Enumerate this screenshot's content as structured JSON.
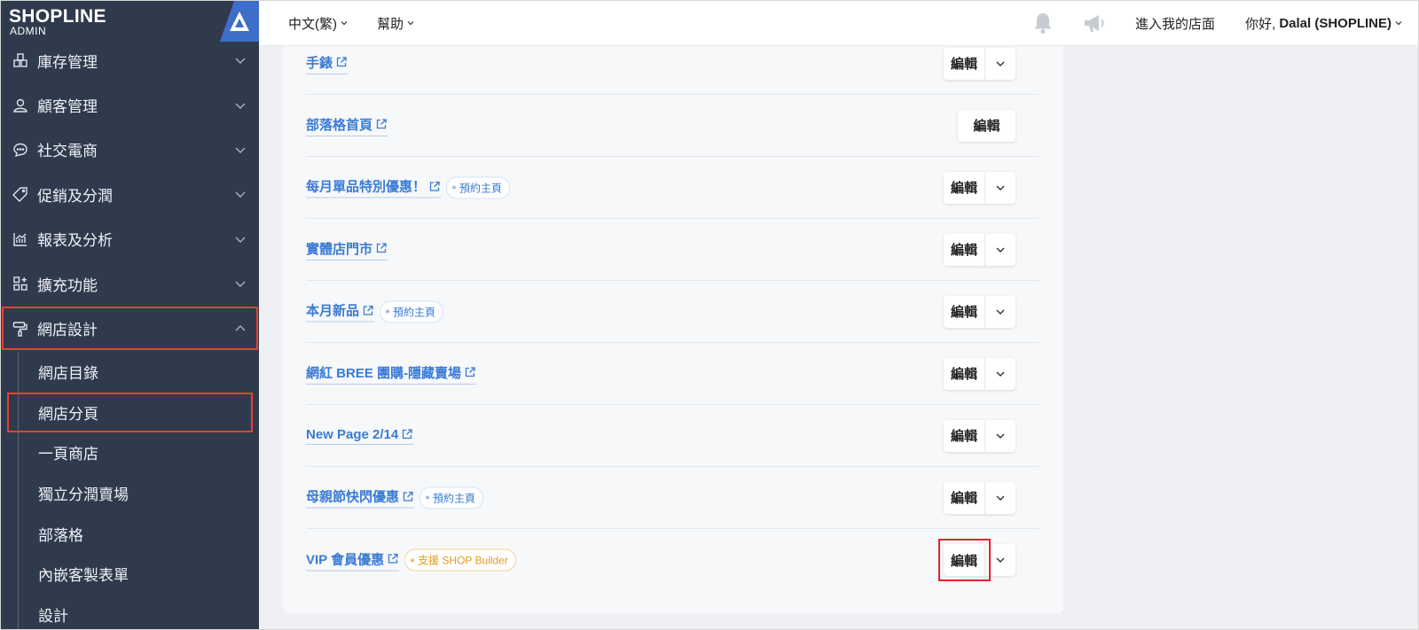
{
  "logo": {
    "brand": "SHOPLINE",
    "sub": "ADMIN"
  },
  "sidebar": {
    "items": [
      {
        "label": "庫存管理",
        "icon": "inventory-icon"
      },
      {
        "label": "顧客管理",
        "icon": "customer-icon"
      },
      {
        "label": "社交電商",
        "icon": "chat-icon"
      },
      {
        "label": "促銷及分潤",
        "icon": "tag-icon"
      },
      {
        "label": "報表及分析",
        "icon": "report-icon"
      },
      {
        "label": "擴充功能",
        "icon": "apps-icon"
      },
      {
        "label": "網店設計",
        "icon": "paint-roller-icon"
      }
    ],
    "sub_items": [
      "網店目錄",
      "網店分頁",
      "一頁商店",
      "獨立分潤賣場",
      "部落格",
      "內嵌客製表單",
      "設計"
    ]
  },
  "topbar": {
    "language": "中文(繁)",
    "help": "幫助",
    "store_link": "進入我的店面",
    "greeting": "你好,",
    "user": "Dalal (SHOPLINE)"
  },
  "pages": [
    {
      "title": "手錶",
      "tag": "",
      "edit": "編輯",
      "has_dropdown": true
    },
    {
      "title": "部落格首頁",
      "tag": "",
      "edit": "編輯",
      "has_dropdown": false
    },
    {
      "title": "每月單品特別優惠！",
      "tag": "預約主頁",
      "edit": "編輯",
      "has_dropdown": true
    },
    {
      "title": "實體店門市",
      "tag": "",
      "edit": "編輯",
      "has_dropdown": true
    },
    {
      "title": "本月新品",
      "tag": "預約主頁",
      "edit": "編輯",
      "has_dropdown": true
    },
    {
      "title": "網紅 BREE 團購-隱藏賣場",
      "tag": "",
      "edit": "編輯",
      "has_dropdown": true
    },
    {
      "title": "New Page 2/14",
      "tag": "",
      "edit": "編輯",
      "has_dropdown": true
    },
    {
      "title": "母親節快閃優惠",
      "tag": "預約主頁",
      "edit": "編輯",
      "has_dropdown": true
    },
    {
      "title": "VIP 會員優惠",
      "tag": "支援 SHOP Builder",
      "edit": "編輯",
      "has_dropdown": true
    }
  ],
  "colors": {
    "sidebar": "#2f3a4d",
    "link": "#3a7bd5",
    "highlight": "#e8402f",
    "accent": "#3d6ec9"
  }
}
